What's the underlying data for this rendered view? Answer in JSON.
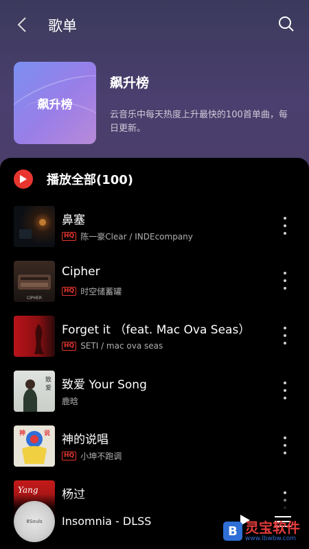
{
  "header": {
    "title": "歌单"
  },
  "playlist": {
    "cover_text": "飙升榜",
    "name": "飙升榜",
    "description": "云音乐中每天热度上升最快的100首单曲，每日更新。"
  },
  "play_all": {
    "label": "播放全部(100)"
  },
  "songs": [
    {
      "title": "鼻塞",
      "hq": "HQ",
      "artist": "陈一豪Clear / INDEcompany",
      "thumb": "dark-room-cover"
    },
    {
      "title": "Cipher",
      "hq": "HQ",
      "artist": "时空储蓄罐",
      "thumb": "typewriter-cover"
    },
    {
      "title": "Forget it （feat. Mac Ova Seas）",
      "hq": "HQ",
      "artist": "SETI / mac ova seas",
      "thumb": "red-figure-cover"
    },
    {
      "title": "致爱 Your Song",
      "hq": "",
      "artist": "鹿晗",
      "thumb": "portrait-cover"
    },
    {
      "title": "神的说唱",
      "hq": "HQ",
      "artist": "小坤不跑调",
      "thumb": "cartoon-cover"
    },
    {
      "title": "杨过",
      "hq": "",
      "artist": "",
      "thumb": "yang-cover"
    }
  ],
  "mini_player": {
    "title": "Insomnia - DLSS",
    "disc_label": "8Souls"
  },
  "watermark": {
    "logo": "B",
    "main": "灵宝软件",
    "sub": "www.lbwbw.com"
  },
  "colors": {
    "accent": "#e8362f",
    "header_top": "#3b3a5c",
    "header_bottom": "#4b3d6a",
    "cover_start": "#7b8ff0",
    "cover_end": "#b88ad8"
  }
}
